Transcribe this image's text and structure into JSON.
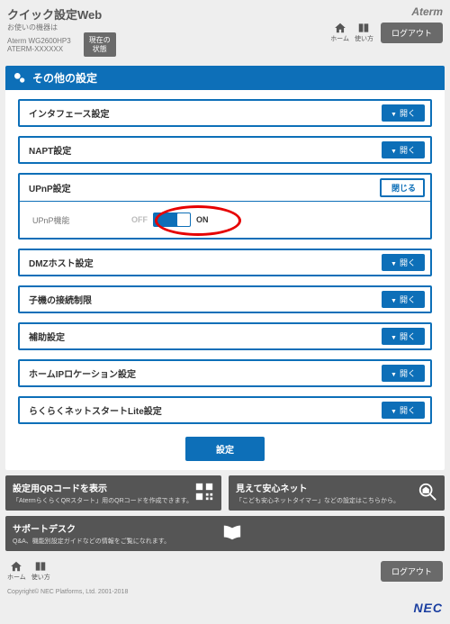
{
  "header": {
    "app_title": "クイック設定Web",
    "sub1": "お使いの機器は",
    "sub2a": "Aterm WG2600HP3",
    "sub2b": "ATERM-XXXXXX",
    "status_btn": "現在の\n状態",
    "brand": "Aterm",
    "nav_home": "ホーム",
    "nav_howto": "使い方",
    "logout": "ログアウト"
  },
  "panel": {
    "title": "その他の設定"
  },
  "rows": [
    {
      "label": "インタフェース設定",
      "open_label": "開く"
    },
    {
      "label": "NAPT設定",
      "open_label": "開く"
    }
  ],
  "upnp": {
    "label": "UPnP設定",
    "close_label": "閉じる",
    "func_label": "UPnP機能",
    "off": "OFF",
    "on": "ON"
  },
  "rows2": [
    {
      "label": "DMZホスト設定",
      "open_label": "開く"
    },
    {
      "label": "子機の接続制限",
      "open_label": "開く"
    },
    {
      "label": "補助設定",
      "open_label": "開く"
    },
    {
      "label": "ホームIPロケーション設定",
      "open_label": "開く"
    },
    {
      "label": "らくらくネットスタートLite設定",
      "open_label": "開く"
    }
  ],
  "set_btn": "設定",
  "cards": {
    "qr": {
      "title": "設定用QRコードを表示",
      "sub": "「AtermらくらくQRスタート」用のQRコードを作成できます。"
    },
    "safe": {
      "title": "見えて安心ネット",
      "sub": "「こども安心ネットタイマー」などの設定はこちらから。"
    },
    "support": {
      "title": "サポートデスク",
      "sub": "Q&A、機能別設定ガイドなどの情報をご覧になれます。"
    }
  },
  "footer": {
    "nav_home": "ホーム",
    "nav_howto": "使い方",
    "logout": "ログアウト",
    "copyright": "Copyright© NEC Platforms, Ltd. 2001-2018",
    "nec": "NEC"
  }
}
